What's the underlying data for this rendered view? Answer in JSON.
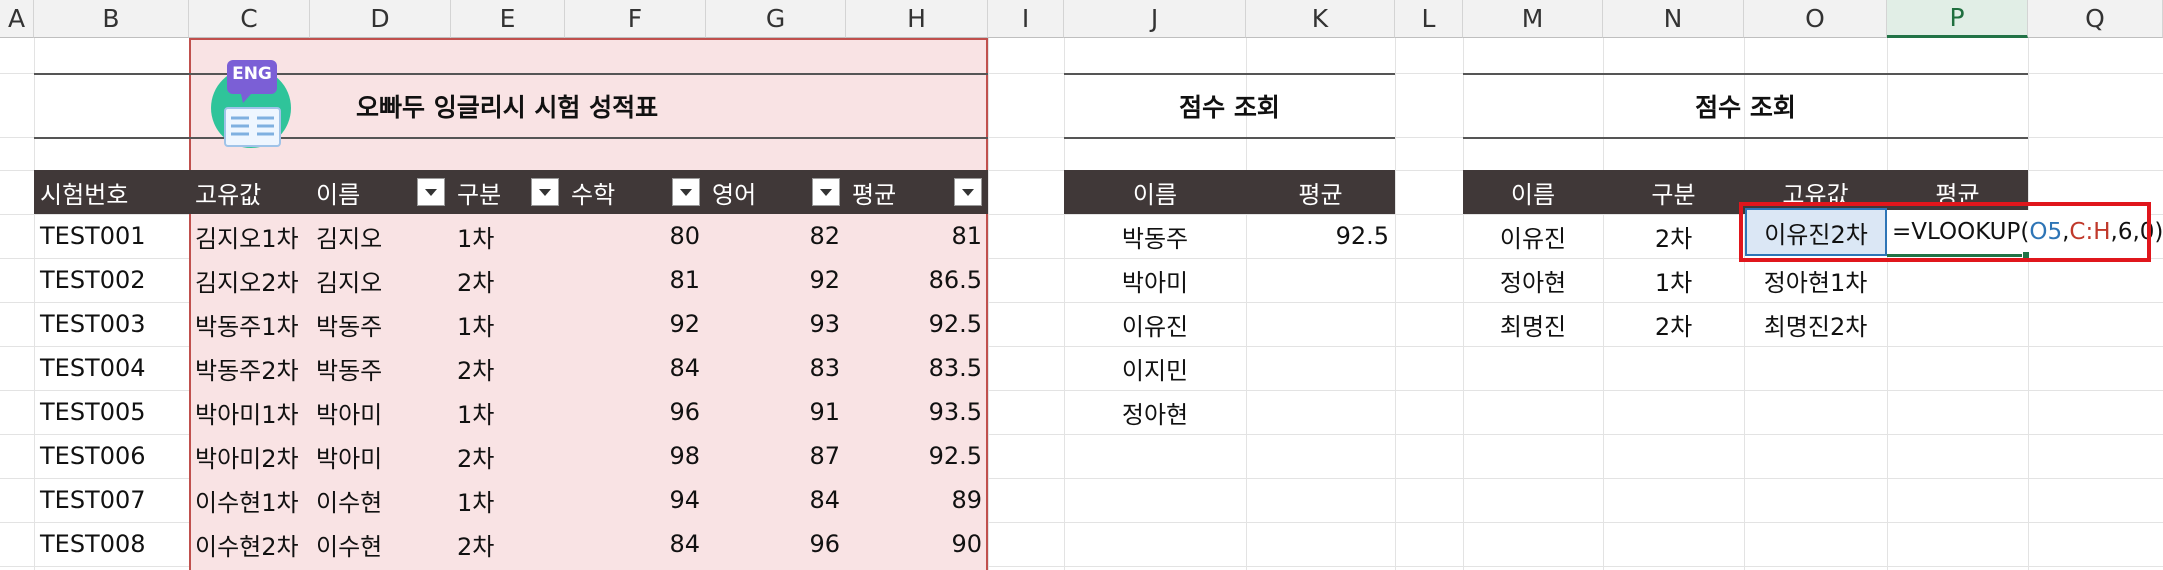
{
  "columns": [
    "A",
    "B",
    "C",
    "D",
    "E",
    "F",
    "G",
    "H",
    "I",
    "J",
    "K",
    "L",
    "M",
    "N",
    "O",
    "P",
    "Q"
  ],
  "selected_column": "P",
  "main_table": {
    "title": "오빠두 잉글리시 시험 성적표",
    "logo_text": "ENG",
    "headers": [
      "시험번호",
      "고유값",
      "이름",
      "구분",
      "수학",
      "영어",
      "평균"
    ],
    "rows": [
      [
        "TEST001",
        "김지오1차",
        "김지오",
        "1차",
        "80",
        "82",
        "81"
      ],
      [
        "TEST002",
        "김지오2차",
        "김지오",
        "2차",
        "81",
        "92",
        "86.5"
      ],
      [
        "TEST003",
        "박동주1차",
        "박동주",
        "1차",
        "92",
        "93",
        "92.5"
      ],
      [
        "TEST004",
        "박동주2차",
        "박동주",
        "2차",
        "84",
        "83",
        "83.5"
      ],
      [
        "TEST005",
        "박아미1차",
        "박아미",
        "1차",
        "96",
        "91",
        "93.5"
      ],
      [
        "TEST006",
        "박아미2차",
        "박아미",
        "2차",
        "98",
        "87",
        "92.5"
      ],
      [
        "TEST007",
        "이수현1차",
        "이수현",
        "1차",
        "94",
        "84",
        "89"
      ],
      [
        "TEST008",
        "이수현2차",
        "이수현",
        "2차",
        "84",
        "96",
        "90"
      ]
    ]
  },
  "lookup1": {
    "title": "점수 조회",
    "headers": [
      "이름",
      "평균"
    ],
    "rows": [
      [
        "박동주",
        "92.5"
      ],
      [
        "박아미",
        ""
      ],
      [
        "이유진",
        ""
      ],
      [
        "이지민",
        ""
      ],
      [
        "정아현",
        ""
      ]
    ]
  },
  "lookup2": {
    "title": "점수 조회",
    "headers": [
      "이름",
      "구분",
      "고유값",
      "평균"
    ],
    "rows": [
      [
        "이유진",
        "2차",
        "이유진2차",
        ""
      ],
      [
        "정아현",
        "1차",
        "정아현1차",
        ""
      ],
      [
        "최명진",
        "2차",
        "최명진2차",
        ""
      ]
    ]
  },
  "formula": {
    "prefix": "=VLOOKUP(",
    "ref1": "O5",
    "sep1": ",",
    "ref2": "C:H",
    "suffix": ",6,0)"
  },
  "colors": {
    "header_bar": "#403838",
    "pink_fill": "#f9e3e4",
    "pink_border": "#c0504d",
    "highlight_box": "#e0161c",
    "ref_blue": "#2e75b6",
    "ref_red": "#c0392b",
    "selection_green": "#217346"
  }
}
